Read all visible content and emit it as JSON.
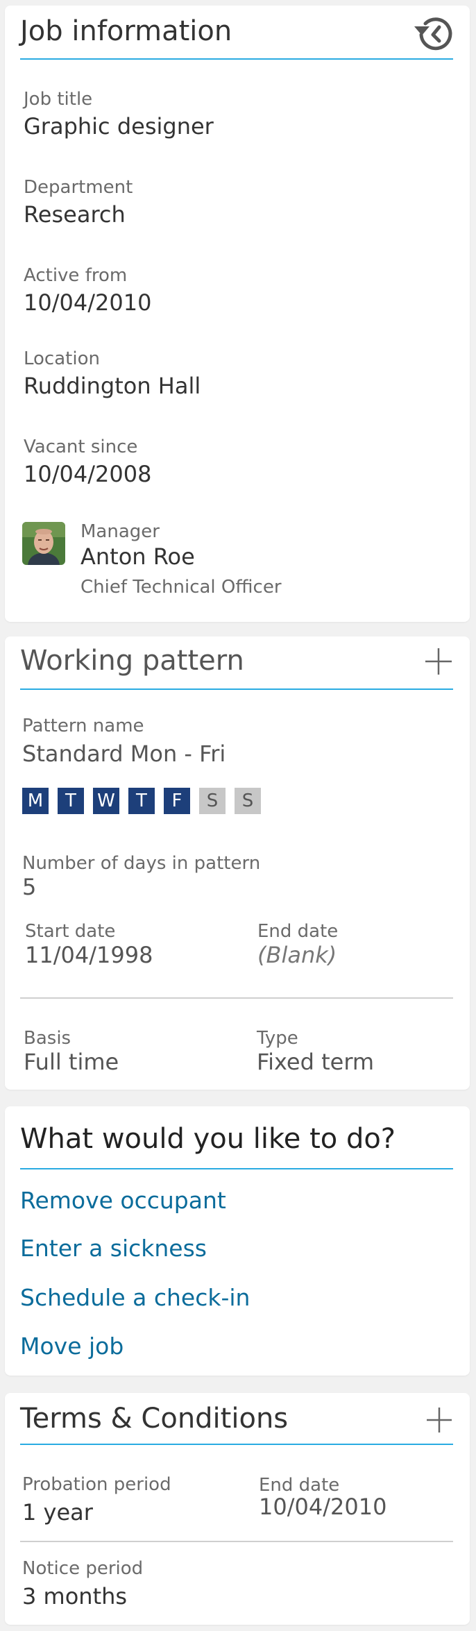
{
  "job_info": {
    "title": "Job information",
    "history_icon": "history-icon",
    "fields": [
      {
        "label": "Job title",
        "value": "Graphic designer"
      },
      {
        "label": "Department",
        "value": "Research"
      },
      {
        "label": "Active from",
        "value": "10/04/2010"
      },
      {
        "label": "Location",
        "value": "Ruddington Hall"
      },
      {
        "label": "Vacant since",
        "value": "10/04/2008"
      }
    ],
    "manager": {
      "label": "Manager",
      "name": "Anton Roe",
      "role": "Chief Technical Officer",
      "avatar_icon": "avatar"
    }
  },
  "working_pattern": {
    "title": "Working pattern",
    "add_icon": "plus-icon",
    "pattern_label": "Pattern name",
    "pattern_value": "Standard Mon - Fri",
    "days": [
      {
        "letter": "M",
        "active": true
      },
      {
        "letter": "T",
        "active": true
      },
      {
        "letter": "W",
        "active": true
      },
      {
        "letter": "T",
        "active": true
      },
      {
        "letter": "F",
        "active": true
      },
      {
        "letter": "S",
        "active": false
      },
      {
        "letter": "S",
        "active": false
      }
    ],
    "days_count_label": "Number of days in pattern",
    "days_count_value": "5",
    "start_label": "Start date",
    "start_value": "11/04/1998",
    "end_label": "End date",
    "end_value": "(Blank)",
    "basis_label": "Basis",
    "basis_value": "Full time",
    "type_label": "Type",
    "type_value": "Fixed term"
  },
  "actions": {
    "title": "What would you like to do?",
    "links": [
      "Remove occupant",
      "Enter a sickness",
      "Schedule a check-in",
      "Move job"
    ]
  },
  "terms": {
    "title": "Terms & Conditions",
    "add_icon": "plus-icon",
    "probation_label": "Probation period",
    "probation_value": "1 year",
    "end_label": "End date",
    "end_value": "10/04/2010",
    "notice_label": "Notice period",
    "notice_value": "3 months"
  },
  "colors": {
    "accent_rule": "#29abe2",
    "link": "#0b6c9b",
    "day_active": "#1d3f7a",
    "day_inactive": "#c7c7c7"
  }
}
